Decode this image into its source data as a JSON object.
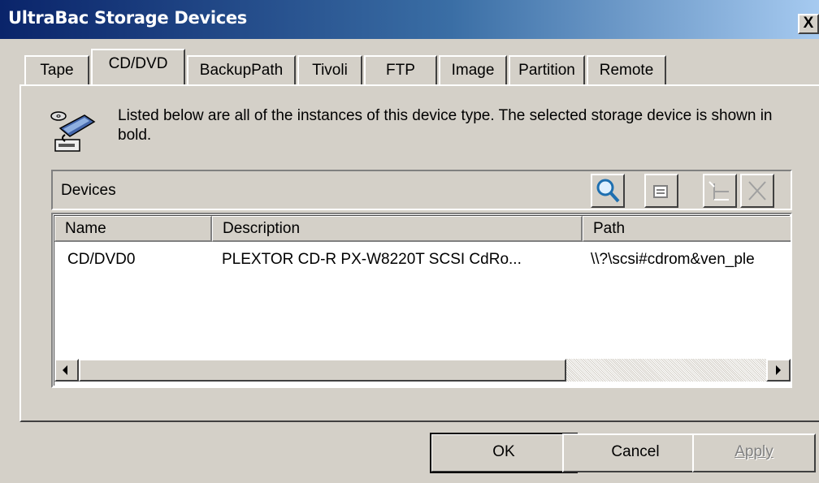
{
  "window": {
    "title": "UltraBac Storage Devices",
    "close_label": "X"
  },
  "tabs": [
    {
      "label": "Tape"
    },
    {
      "label": "CD/DVD"
    },
    {
      "label": "BackupPath"
    },
    {
      "label": "Tivoli"
    },
    {
      "label": "FTP"
    },
    {
      "label": "Image"
    },
    {
      "label": "Partition"
    },
    {
      "label": "Remote"
    }
  ],
  "active_tab": "CD/DVD",
  "description": "Listed below are all of the instances of this device type. The selected storage device is shown in bold.",
  "devices_toolbar": {
    "label": "Devices",
    "buttons": [
      "search-icon",
      "properties-icon",
      "add-icon",
      "delete-icon"
    ]
  },
  "table": {
    "columns": [
      "Name",
      "Description",
      "Path"
    ],
    "rows": [
      {
        "name": "CD/DVD0",
        "description": "PLEXTOR CD-R   PX-W8220T SCSI CdRo...",
        "path": "\\\\?\\scsi#cdrom&ven_ple"
      }
    ]
  },
  "buttons": {
    "ok": "OK",
    "cancel": "Cancel",
    "apply": "Apply"
  },
  "colors": {
    "face": "#d4d0c8",
    "title_start": "#0a246a",
    "title_end": "#a6caf0",
    "search_icon": "#1e6fb0"
  }
}
